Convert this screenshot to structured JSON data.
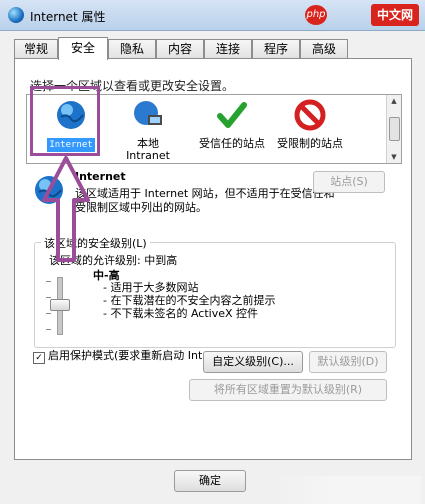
{
  "window": {
    "title": "Internet 属性"
  },
  "watermark": {
    "text": "中文网",
    "logo_text": "php"
  },
  "tabs": [
    {
      "label": "常规"
    },
    {
      "label": "安全",
      "active": true
    },
    {
      "label": "隐私"
    },
    {
      "label": "内容"
    },
    {
      "label": "连接"
    },
    {
      "label": "程序"
    },
    {
      "label": "高级"
    }
  ],
  "security": {
    "hint": "选择一个区域以查看或更改安全设置。",
    "zones": [
      {
        "label": "Internet",
        "icon": "globe-icon",
        "selected": true
      },
      {
        "label": "本地 Intranet",
        "icon": "network-globe-icon"
      },
      {
        "label": "受信任的站点",
        "icon": "green-check-icon"
      },
      {
        "label": "受限制的站点",
        "icon": "red-block-icon"
      }
    ],
    "selected_zone_title": "Internet",
    "selected_zone_desc": "该区域适用于 Internet 网站，但不适用于在受信任和受限制区域中列出的网站。",
    "sites_button": "站点(S)",
    "level_group_title": "该区域的安全级别(L)",
    "allowed_levels": "该区域的允许级别: 中到高",
    "level_name": "中-高",
    "level_bullets": [
      "- 适用于大多数网站",
      "- 在下载潜在的不安全内容之前提示",
      "- 不下载未签名的 ActiveX 控件"
    ],
    "level_value_fraction": 0.6,
    "protected_mode": "启用保护模式(要求重新启动 Internet Explorer)(P)",
    "protected_checked": true,
    "custom_level_button": "自定义级别(C)...",
    "default_level_button": "默认级别(D)",
    "reset_all_button": "将所有区域重置为默认级别(R)"
  },
  "footer": {
    "ok_button": "确定"
  },
  "colors": {
    "annotation_purple": "#9b4d9a",
    "selection_blue": "#3399ff"
  }
}
